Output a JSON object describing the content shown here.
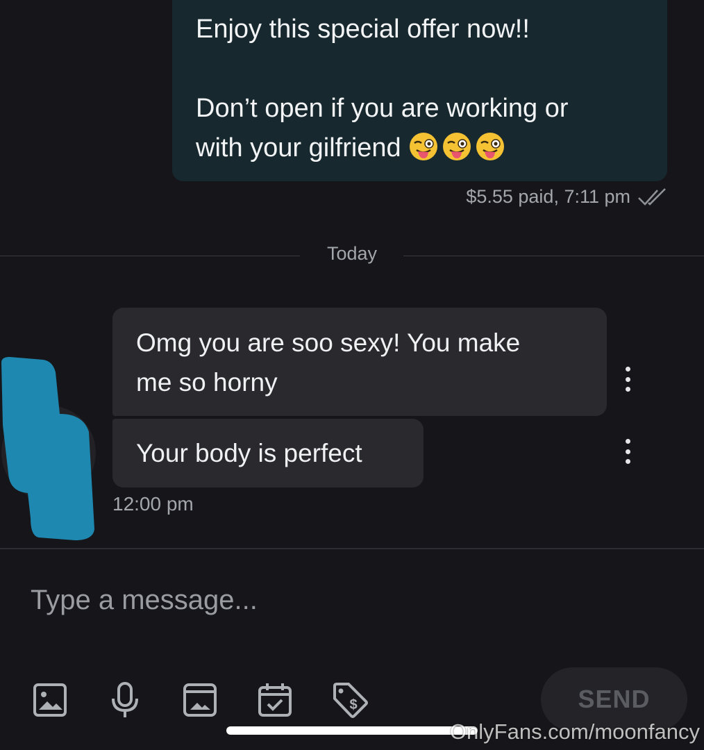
{
  "conversation": {
    "outgoing": {
      "lines": [
        "Enjoy this special offer now!!",
        "",
        "Don’t open if you are working or",
        "with your gilfriend"
      ],
      "emojis": [
        "winking-face-with-tongue-icon",
        "winking-face-with-tongue-icon",
        "winking-face-with-tongue-icon"
      ],
      "meta": "$5.55 paid, 7:11 pm",
      "status_icon": "double-check-icon"
    },
    "divider": "Today",
    "incoming": {
      "messages": [
        {
          "lines": [
            "Omg you are soo sexy! You make",
            "me so horny"
          ]
        },
        {
          "lines": [
            "Your body is perfect"
          ]
        }
      ],
      "time": "12:00 pm",
      "avatar_color": "#1e88b0"
    }
  },
  "composer": {
    "placeholder": "Type a message...",
    "tools": [
      "image-icon",
      "microphone-icon",
      "media-vault-icon",
      "calendar-check-icon",
      "price-tag-icon"
    ],
    "send_label": "SEND"
  },
  "watermark": "OnlyFans.com/moonfancy",
  "colors": {
    "background": "#16161a",
    "outgoing_bubble": "#17282e",
    "incoming_bubble": "#2a2a2e",
    "muted_text": "#a3a6ab"
  }
}
